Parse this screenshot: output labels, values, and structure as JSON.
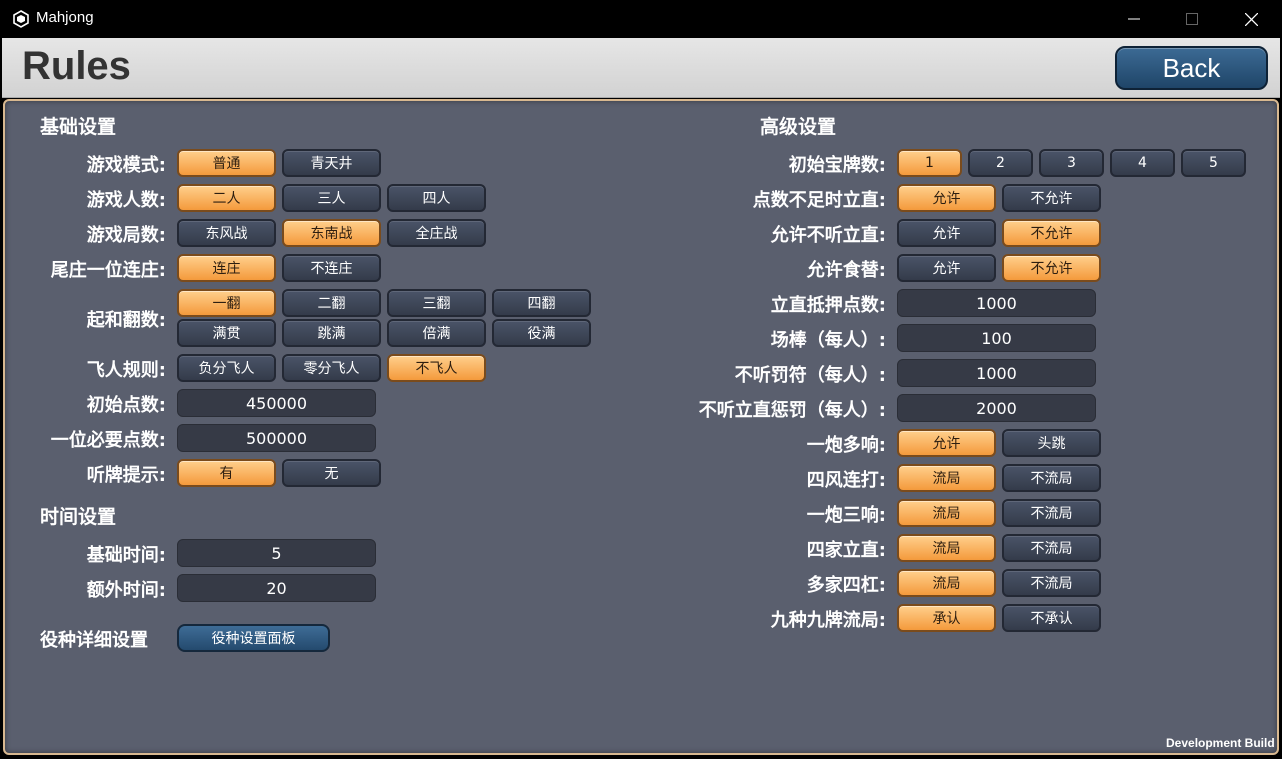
{
  "window": {
    "title": "Mahjong"
  },
  "header": {
    "title": "Rules",
    "back_label": "Back"
  },
  "basic": {
    "section_title": "基础设置",
    "game_mode": {
      "label": "游戏模式:",
      "options": [
        "普通",
        "青天井"
      ],
      "selected": 0
    },
    "players": {
      "label": "游戏人数:",
      "options": [
        "二人",
        "三人",
        "四人"
      ],
      "selected": 0
    },
    "rounds": {
      "label": "游戏局数:",
      "options": [
        "东风战",
        "东南战",
        "全庄战"
      ],
      "selected": 1
    },
    "last_dealer": {
      "label": "尾庄一位连庄:",
      "options": [
        "连庄",
        "不连庄"
      ],
      "selected": 0
    },
    "min_han": {
      "label": "起和翻数:",
      "options": [
        "一翻",
        "二翻",
        "三翻",
        "四翻",
        "满贯",
        "跳满",
        "倍满",
        "役满"
      ],
      "selected": 0
    },
    "bust": {
      "label": "飞人规则:",
      "options": [
        "负分飞人",
        "零分飞人",
        "不飞人"
      ],
      "selected": 2
    },
    "start_points": {
      "label": "初始点数:",
      "value": "450000"
    },
    "first_place_points": {
      "label": "一位必要点数:",
      "value": "500000"
    },
    "tenpai_hint": {
      "label": "听牌提示:",
      "options": [
        "有",
        "无"
      ],
      "selected": 0
    }
  },
  "time": {
    "section_title": "时间设置",
    "base_time": {
      "label": "基础时间:",
      "value": "5"
    },
    "extra_time": {
      "label": "额外时间:",
      "value": "20"
    }
  },
  "yaku": {
    "label": "役种详细设置",
    "button_label": "役种设置面板"
  },
  "advanced": {
    "section_title": "高级设置",
    "dora_count": {
      "label": "初始宝牌数:",
      "options": [
        "1",
        "2",
        "3",
        "4",
        "5"
      ],
      "selected": 0
    },
    "riichi_low_points": {
      "label": "点数不足时立直:",
      "options": [
        "允许",
        "不允许"
      ],
      "selected": 0
    },
    "riichi_no_ten": {
      "label": "允许不听立直:",
      "options": [
        "允许",
        "不允许"
      ],
      "selected": 1
    },
    "kuikae": {
      "label": "允许食替:",
      "options": [
        "允许",
        "不允许"
      ],
      "selected": 1
    },
    "riichi_deposit": {
      "label": "立直抵押点数:",
      "value": "1000"
    },
    "honba": {
      "label": "场棒（每人）:",
      "value": "100"
    },
    "noten_penalty": {
      "label": "不听罚符（每人）:",
      "value": "1000"
    },
    "noten_riichi_penalty": {
      "label": "不听立直惩罚（每人）:",
      "value": "2000"
    },
    "multi_ron": {
      "label": "一炮多响:",
      "options": [
        "允许",
        "头跳"
      ],
      "selected": 0
    },
    "four_winds": {
      "label": "四风连打:",
      "options": [
        "流局",
        "不流局"
      ],
      "selected": 0
    },
    "triple_ron": {
      "label": "一炮三响:",
      "options": [
        "流局",
        "不流局"
      ],
      "selected": 0
    },
    "four_riichi": {
      "label": "四家立直:",
      "options": [
        "流局",
        "不流局"
      ],
      "selected": 0
    },
    "four_kan": {
      "label": "多家四杠:",
      "options": [
        "流局",
        "不流局"
      ],
      "selected": 0
    },
    "nine_terminals": {
      "label": "九种九牌流局:",
      "options": [
        "承认",
        "不承认"
      ],
      "selected": 0
    }
  },
  "footer": {
    "dev_build": "Development Build"
  }
}
